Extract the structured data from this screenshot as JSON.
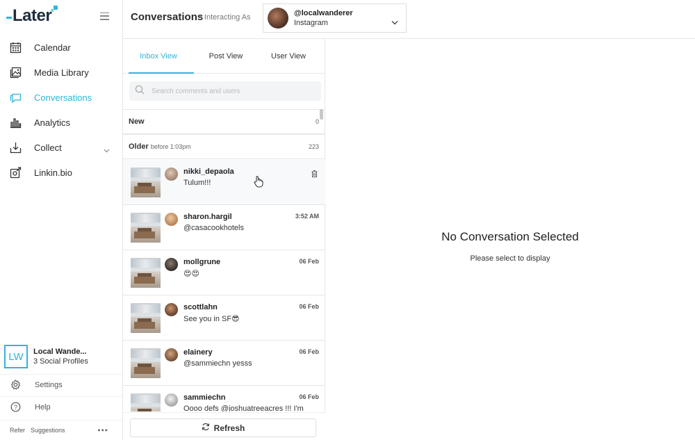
{
  "app": {
    "logo_text": "Later"
  },
  "sidebar": {
    "items": [
      {
        "label": "Calendar",
        "icon": "calendar-icon"
      },
      {
        "label": "Media Library",
        "icon": "image-icon"
      },
      {
        "label": "Conversations",
        "icon": "chat-icon",
        "active": true
      },
      {
        "label": "Analytics",
        "icon": "bar-chart-icon"
      },
      {
        "label": "Collect",
        "icon": "download-tray-icon",
        "has_dropdown": true
      },
      {
        "label": "Linkin.bio",
        "icon": "link-icon"
      }
    ],
    "profile": {
      "initials": "LW",
      "name": "Local Wande...",
      "subtitle": "3 Social Profiles"
    },
    "settings_label": "Settings",
    "help_label": "Help",
    "refer_label": "Refer",
    "suggestions_label": "Suggestions",
    "more_label": "•••"
  },
  "header": {
    "title": "Conversations",
    "subtitle": "• Interacting As",
    "account": {
      "handle": "@localwanderer",
      "platform": "Instagram"
    }
  },
  "tabs": [
    {
      "label": "Inbox View",
      "active": true
    },
    {
      "label": "Post View"
    },
    {
      "label": "User View"
    }
  ],
  "search": {
    "placeholder": "Search comments and users"
  },
  "sections": {
    "new": {
      "label": "New",
      "count": "0"
    },
    "older": {
      "label": "Older",
      "sub": "before 1:03pm",
      "count": "223"
    }
  },
  "conversations": [
    {
      "user": "nikki_depaola",
      "message": "Tulum!!!",
      "time": "",
      "hover": true
    },
    {
      "user": "sharon.hargil",
      "message": "@casacookhotels",
      "time": "3:52 AM"
    },
    {
      "user": "mollgrune",
      "message": "😍😍",
      "time": "06 Feb"
    },
    {
      "user": "scottlahn",
      "message": "See you in SF😎",
      "time": "06 Feb"
    },
    {
      "user": "elainery",
      "message": "@sammiechn yesss",
      "time": "06 Feb"
    },
    {
      "user": "sammiechn",
      "message": "Oooo defs @joshuatreeacres !!! I'm",
      "time": "06 Feb"
    }
  ],
  "refresh_label": "Refresh",
  "detail": {
    "title": "No Conversation Selected",
    "subtitle": "Please select to display"
  },
  "colors": {
    "accent": "#30b4d9",
    "text": "#222222",
    "border": "#e6e6e6"
  }
}
